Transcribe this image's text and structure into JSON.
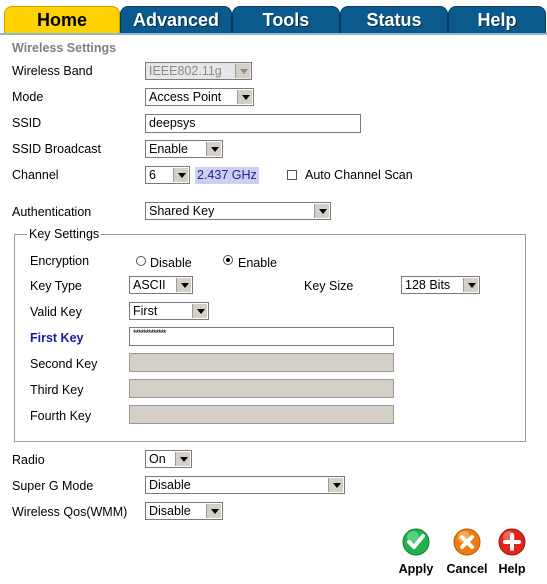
{
  "tabs": {
    "home": "Home",
    "advanced": "Advanced",
    "tools": "Tools",
    "status": "Status",
    "help": "Help"
  },
  "section": {
    "title": "Wireless Settings"
  },
  "fields": {
    "wireless_band": {
      "label": "Wireless Band",
      "value": "IEEE802.11g"
    },
    "mode": {
      "label": "Mode",
      "value": "Access Point"
    },
    "ssid": {
      "label": "SSID",
      "value": "deepsys"
    },
    "ssid_broadcast": {
      "label": "SSID Broadcast",
      "value": "Enable"
    },
    "channel": {
      "label": "Channel",
      "value": "6",
      "frequency": "2.437 GHz",
      "auto_scan_label": "Auto Channel Scan",
      "auto_scan_checked": false
    },
    "authentication": {
      "label": "Authentication",
      "value": "Shared Key"
    }
  },
  "key_settings": {
    "legend": "Key Settings",
    "encryption": {
      "label": "Encryption",
      "options": [
        "Disable",
        "Enable"
      ],
      "selected": "Enable"
    },
    "key_type": {
      "label": "Key Type",
      "value": "ASCII"
    },
    "key_size": {
      "label": "Key Size",
      "value": "128 Bits"
    },
    "valid_key": {
      "label": "Valid Key",
      "value": "First"
    },
    "first_key": {
      "label": "First Key",
      "value": "*************"
    },
    "second_key": {
      "label": "Second Key",
      "value": ""
    },
    "third_key": {
      "label": "Third Key",
      "value": ""
    },
    "fourth_key": {
      "label": "Fourth Key",
      "value": ""
    }
  },
  "bottom": {
    "radio": {
      "label": "Radio",
      "value": "On"
    },
    "super_g": {
      "label": "Super G Mode",
      "value": "Disable"
    },
    "qos": {
      "label": "Wireless Qos(WMM)",
      "value": "Disable"
    }
  },
  "buttons": {
    "apply": "Apply",
    "cancel": "Cancel",
    "help": "Help"
  },
  "colors": {
    "tab_active": "#ffd200",
    "tab_inactive": "#0a5a8e",
    "apply": "#22b14c",
    "cancel": "#f07d12",
    "help": "#e2231a",
    "first_key_label": "#1a1aa6"
  },
  "icons": {
    "apply": "check-icon",
    "cancel": "x-icon",
    "help": "plus-icon"
  }
}
